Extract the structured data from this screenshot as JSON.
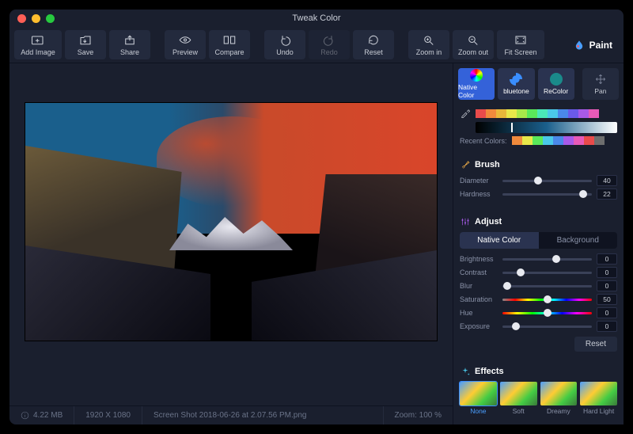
{
  "window": {
    "title": "Tweak Color"
  },
  "toolbar": {
    "add_image": "Add Image",
    "save": "Save",
    "share": "Share",
    "preview": "Preview",
    "compare": "Compare",
    "undo": "Undo",
    "redo": "Redo",
    "reset": "Reset",
    "zoom_in": "Zoom in",
    "zoom_out": "Zoom out",
    "fit_screen": "Fit Screen"
  },
  "status": {
    "filesize": "4.22 MB",
    "dimensions": "1920 X 1080",
    "filename": "Screen Shot 2018-06-26 at 2.07.56 PM.png",
    "zoom": "Zoom: 100 %"
  },
  "paint": {
    "title": "Paint",
    "modes": {
      "native": "Native Color",
      "bluetone": "bluetone",
      "recolor": "ReColor",
      "pan": "Pan"
    },
    "recent_label": "Recent Colors:",
    "palette": [
      "#e94b4b",
      "#f08a3c",
      "#e8b83a",
      "#e8e84a",
      "#a8e84a",
      "#5ae85a",
      "#4ae8b8",
      "#4ac8e8",
      "#4a88e8",
      "#6a5ae8",
      "#a85ae8",
      "#e85ab8"
    ],
    "recent": [
      "#f08a3c",
      "#e8e84a",
      "#5ae85a",
      "#4ac8e8",
      "#4a88e8",
      "#a85ae8",
      "#e85ab8",
      "#e94b4b",
      "#6e6e6e"
    ]
  },
  "brush": {
    "title": "Brush",
    "diameter_label": "Diameter",
    "diameter_value": "40",
    "hardness_label": "Hardness",
    "hardness_value": "22"
  },
  "adjust": {
    "title": "Adjust",
    "tab_native": "Native Color",
    "tab_background": "Background",
    "brightness_label": "Brightness",
    "brightness_value": "0",
    "contrast_label": "Contrast",
    "contrast_value": "0",
    "blur_label": "Blur",
    "blur_value": "0",
    "saturation_label": "Saturation",
    "saturation_value": "50",
    "hue_label": "Hue",
    "hue_value": "0",
    "exposure_label": "Exposure",
    "exposure_value": "0",
    "reset": "Reset"
  },
  "effects": {
    "title": "Effects",
    "items": [
      "None",
      "Soft",
      "Dreamy",
      "Hard Light"
    ]
  }
}
